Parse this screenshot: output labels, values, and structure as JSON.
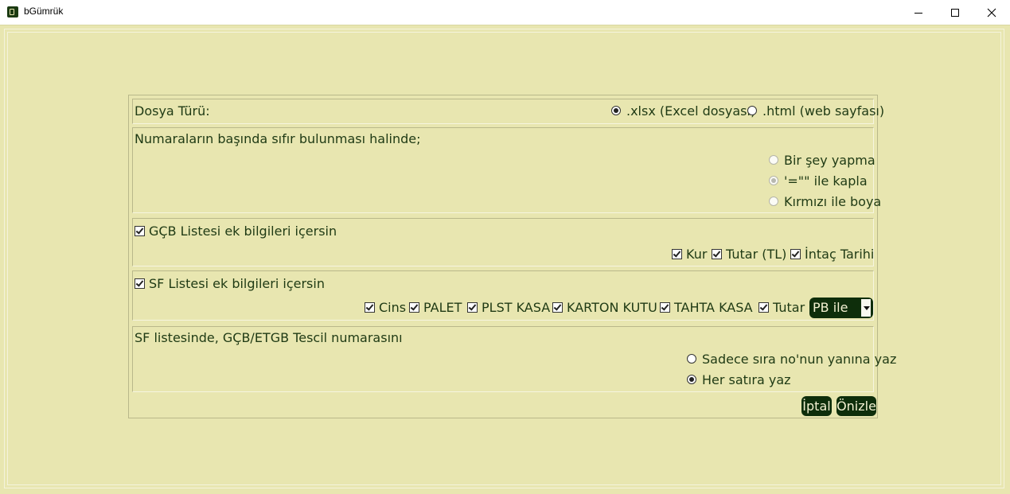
{
  "window": {
    "title": "bGümrük"
  },
  "file_type": {
    "label": "Dosya Türü:",
    "options": [
      {
        "label": ".xlsx (Excel dosyası)",
        "selected": true
      },
      {
        "label": ".html (web sayfası)",
        "selected": false
      }
    ]
  },
  "leading_zeros": {
    "label": "Numaraların başında sıfır bulunması halinde;",
    "options": [
      {
        "label": "Bir şey yapma",
        "selected": false,
        "enabled": false
      },
      {
        "label": "'=\"\" ile kapla",
        "selected": true,
        "enabled": false
      },
      {
        "label": "Kırmızı ile boya",
        "selected": false,
        "enabled": false
      }
    ]
  },
  "gcb_list": {
    "label": "GÇB Listesi ek bilgileri içersin",
    "checked": true,
    "fields": [
      {
        "label": "Kur",
        "checked": true
      },
      {
        "label": "Tutar (TL)",
        "checked": true
      },
      {
        "label": "İntaç Tarihi",
        "checked": true
      }
    ]
  },
  "sf_list": {
    "label": "SF Listesi ek bilgileri içersin",
    "checked": true,
    "fields": [
      {
        "label": "Cins",
        "checked": true
      },
      {
        "label": "PALET",
        "checked": true
      },
      {
        "label": "PLST KASA",
        "checked": true
      },
      {
        "label": "KARTON KUTU",
        "checked": true
      },
      {
        "label": "TAHTA KASA",
        "checked": true
      },
      {
        "label": "Tutar",
        "checked": true
      }
    ],
    "currency_select": "PB ile"
  },
  "registration_no": {
    "label": "SF listesinde, GÇB/ETGB Tescil numarasını",
    "options": [
      {
        "label": "Sadece sıra no'nun yanına yaz",
        "selected": false
      },
      {
        "label": "Her satıra yaz",
        "selected": true
      }
    ]
  },
  "buttons": {
    "cancel": "İptal",
    "preview": "Önizle"
  },
  "colors": {
    "background": "#e8e6b0",
    "accent": "#0e2e0b",
    "text": "#1f3a14"
  }
}
